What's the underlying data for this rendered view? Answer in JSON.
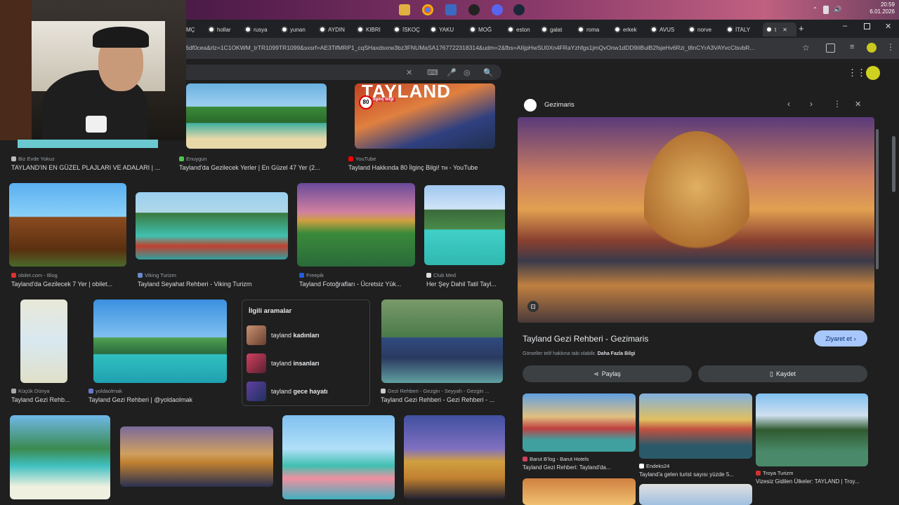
{
  "os": {
    "clock_time": "20:59",
    "clock_date": "6.01.2026"
  },
  "tabs": [
    "MÇ",
    "hollar",
    "rusya",
    "yunan",
    "AYDIN",
    "KIBRI",
    "İSKOÇ",
    "YAKU",
    "MOĞ",
    "eston",
    "galat",
    "roma",
    "erkek",
    "AVUS",
    "norve",
    "İTALY",
    "t"
  ],
  "address": {
    "url": "6df0cea&rlz=1C1OKWM_trTR1099TR1099&sxsrf=AE3TifMRP1_cqSHaxdsxrw3bz3FNUMaSA1767722318314&udm=2&fbs=AIIjpHwSU0Xn4FRaYzhfgs1jmQvOnw1dDD9iIBulB2fsjeHv6Rzi_t8nCYrA3VAYvcClsvbR..."
  },
  "results": {
    "row1": [
      {
        "source": "Biz Evde Yokuz",
        "title": "TAYLAND'IN EN GÜZEL PLAJLARI VE ADALARI | ..."
      },
      {
        "source": "Enuygun",
        "title": "Tayland'da Gezilecek Yerler | En Güzel 47 Yer (2..."
      },
      {
        "source": "YouTube",
        "title": "Tayland Hakkında 80 İlginç Bilgi! ᴛʜ - YouTube",
        "overlay": "TAYLAND",
        "badge": "80",
        "badge_text": "ilginç bilgi"
      }
    ],
    "row2": [
      {
        "source": "obilet.com - Blog",
        "title": "Tayland'da Gezilecek 7 Yer | obilet..."
      },
      {
        "source": "Viking Turizm",
        "title": "Tayland Seyahat Rehberi - Viking Turizm"
      },
      {
        "source": "Freepik",
        "title": "Tayland Fotoğrafları - Ücretsiz Yük..."
      },
      {
        "source": "Club Med",
        "title": "Her Şey Dahil Tatil Tayl..."
      }
    ],
    "row3": [
      {
        "source": "Küçük Dünya",
        "title": "Tayland Gezi Rehb..."
      },
      {
        "source": "yoldaolmak",
        "title": "Tayland Gezi Rehberi | @yoldaolmak"
      },
      {
        "source": "Gezi Rehberi - Gezgin - Seyyah - Gezgin ...",
        "title": "Tayland Gezi Rehberi - Gezi Rehberi - ..."
      }
    ],
    "related": {
      "heading": "İlgili aramalar",
      "items": [
        {
          "prefix": "tayland",
          "bold": "kadınları"
        },
        {
          "prefix": "tayland",
          "bold": "insanları"
        },
        {
          "prefix": "tayland",
          "bold": "gece hayatı"
        }
      ]
    }
  },
  "panel": {
    "site_name": "Gezimaris",
    "title": "Tayland Gezi Rehberi - Gezimaris",
    "visit_label": "Ziyaret et",
    "copyright_note": "Görseller telif hakkına tabi olabilir.",
    "more_info": "Daha Fazla Bilgi",
    "share_label": "Paylaş",
    "save_label": "Kaydet",
    "related": [
      {
        "source": "Barut B'log - Barut Hotels",
        "title": "Tayland Gezi Rehberi: Tayland'da..."
      },
      {
        "source": "Endeks24",
        "title": "Tayland'a gelen turist sayısı yüzde 5..."
      },
      {
        "source": "Troya Turizm",
        "title": "Vizesiz Gidilen Ülkeler: TAYLAND | Troy..."
      }
    ]
  },
  "colors": {
    "accent": "#8ab4f8",
    "visit_bg": "#a8c7fa",
    "visit_fg": "#062e6f"
  }
}
